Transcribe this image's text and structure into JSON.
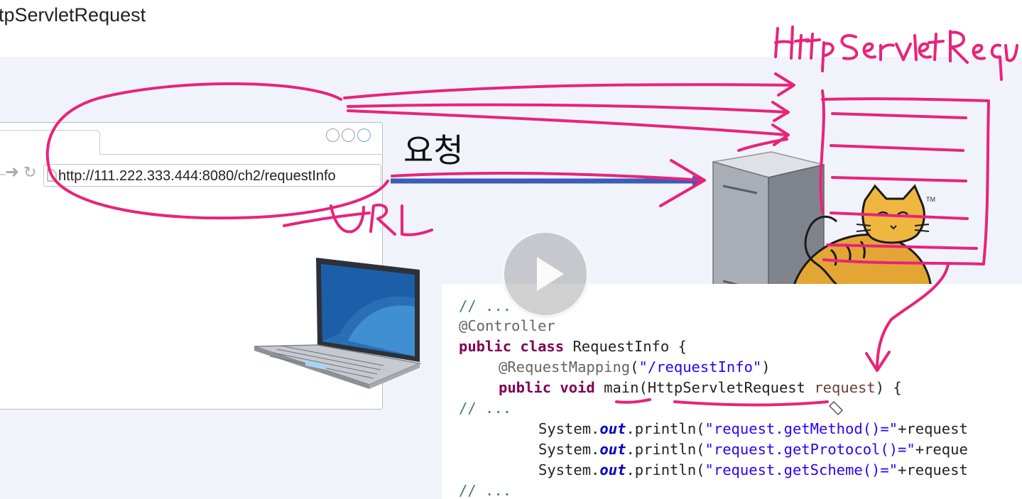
{
  "slide": {
    "title": "tpServletRequest",
    "request_label": "요청",
    "handwriting": {
      "object_label": "HttpServletRequest",
      "url_label": "URL"
    }
  },
  "browser": {
    "url": "http://111.222.333.444:8080/ch2/requestInfo",
    "nav_icons": [
      "back-arrow-icon",
      "forward-arrow-icon",
      "reload-icon",
      "page-icon"
    ],
    "window_buttons": [
      "circle",
      "circle",
      "circle"
    ]
  },
  "code": {
    "lines": [
      "// ...",
      "@Controller",
      "public class RequestInfo {",
      "@RequestMapping(\"/requestInfo\")",
      "public void main(HttpServletRequest request) {",
      "// ...",
      "System.out.println(\"request.getMethod()=\"+request",
      "System.out.println(\"request.getProtocol()=\"+reque",
      "System.out.println(\"request.getScheme()=\"+request",
      "// ..."
    ]
  },
  "server": {
    "trademark": "TM"
  },
  "colors": {
    "annotation_pink": "#e8237a",
    "arrow_blue": "#3b5cb8",
    "slide_bg": "#f1f3fb",
    "keyword": "#7f0055",
    "string": "#2a00ff",
    "comment": "#3f7f5f"
  },
  "player": {
    "icon": "play-icon"
  }
}
